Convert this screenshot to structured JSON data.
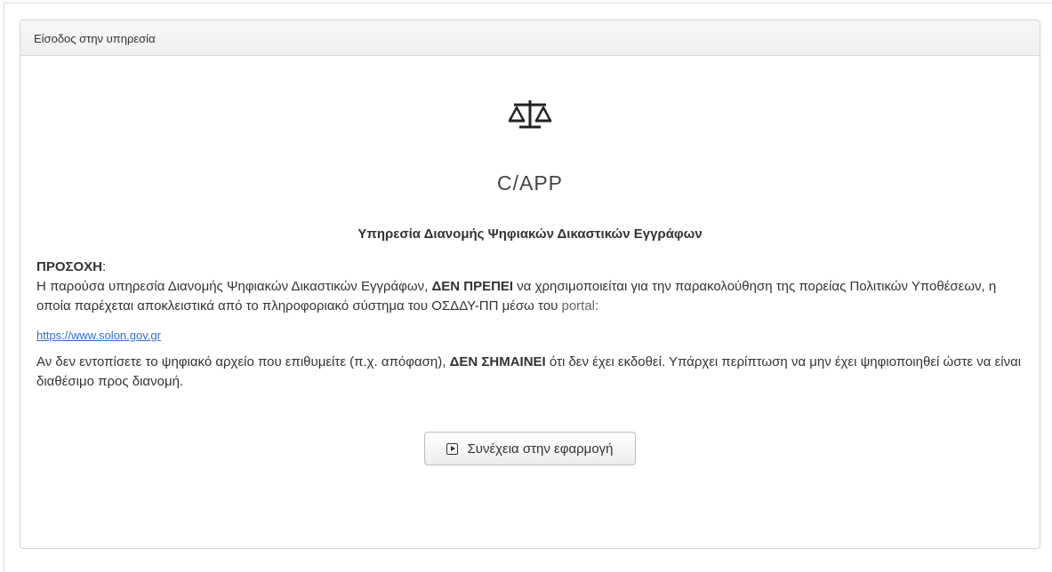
{
  "panel": {
    "heading": "Είσοδος στην υπηρεσία"
  },
  "logo": {
    "icon": "scales-of-justice-icon"
  },
  "app": {
    "name": "C/APP"
  },
  "service": {
    "title": "Υπηρεσία Διανομής Ψηφιακών Δικαστικών Εγγράφων"
  },
  "warning": {
    "title": "ΠΡΟΣΟΧΗ",
    "colon": ":",
    "p1_part1": "Η παρούσα υπηρεσία Διανομής Ψηφιακών Δικαστικών Εγγράφων, ",
    "p1_bold": "ΔΕΝ ΠΡΕΠΕΙ",
    "p1_part2": " να χρησιμοποιείται για την παρακολούθηση της πορείας Πολιτικών Υποθέσεων, η οποία παρέχεται αποκλειστικά από το πληροφοριακό σύστημα του ΟΣΔΔΥ-ΠΠ μέσω του ",
    "p1_portal": "portal:",
    "link": "https://www.solon.gov.gr",
    "p2_part1": "Αν δεν εντοπίσετε το ψηφιακό αρχείο που επιθυμείτε (π.χ. απόφαση), ",
    "p2_bold": "ΔΕΝ ΣΗΜΑΙΝΕΙ",
    "p2_part2": " ότι δεν έχει εκδοθεί. Υπάρχει περίπτωση να μην έχει ψηφιοποιηθεί ώστε να είναι διαθέσιμο προς διανομή."
  },
  "continue_button": {
    "label": "Συνέχεια στην εφαρμογή",
    "icon": "play-icon"
  }
}
